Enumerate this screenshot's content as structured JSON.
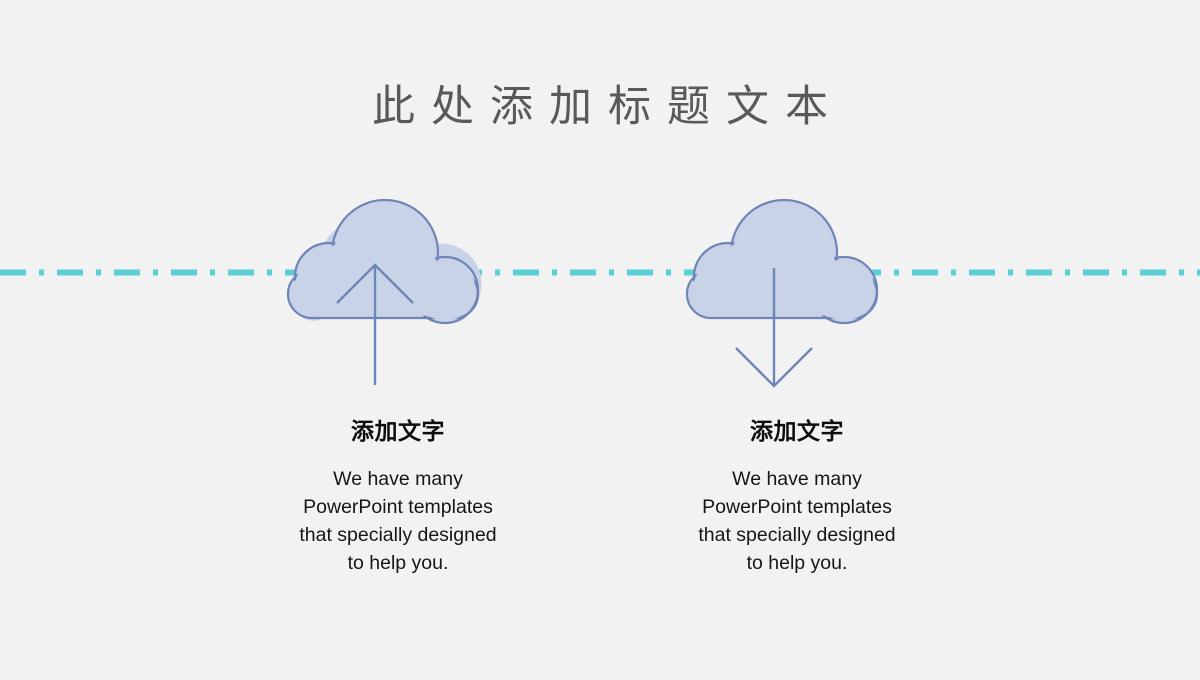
{
  "slide": {
    "title": "此处添加标题文本",
    "background_color": "#F2F2F2",
    "title_color": "#595959"
  },
  "divider": {
    "name": "dash-dot-divider",
    "color": "#5BCFD6",
    "pattern": "dash-dot",
    "thickness_px": 6
  },
  "columns": [
    {
      "icon": "cloud-upload-icon",
      "arrow_direction": "up",
      "cloud_fill": "#C9D3E8",
      "cloud_stroke": "#6E85B7",
      "heading": "添加文字",
      "body_lines": [
        "We have many",
        "PowerPoint templates",
        "that specially designed",
        "to help you."
      ]
    },
    {
      "icon": "cloud-download-icon",
      "arrow_direction": "down",
      "cloud_fill": "#C9D3E8",
      "cloud_stroke": "#6E85B7",
      "heading": "添加文字",
      "body_lines": [
        "We have many",
        "PowerPoint templates",
        "that specially designed",
        "to help you."
      ]
    }
  ]
}
